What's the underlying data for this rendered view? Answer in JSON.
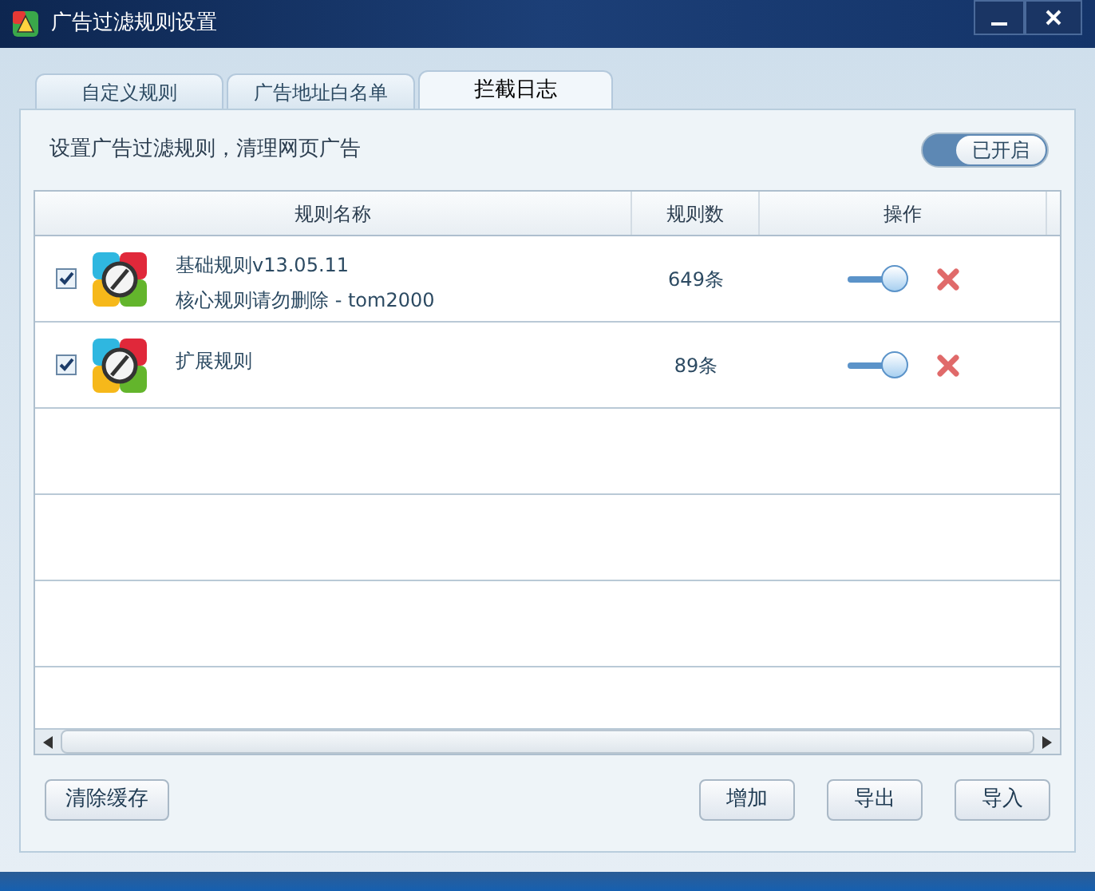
{
  "window": {
    "title": "广告过滤规则设置"
  },
  "tabs": [
    {
      "label": "自定义规则",
      "selected": false
    },
    {
      "label": "广告地址白名单",
      "selected": false
    },
    {
      "label": "拦截日志",
      "selected": true
    }
  ],
  "description": "设置广告过滤规则，清理网页广告",
  "master_switch": {
    "on": true,
    "label": "已开启"
  },
  "table": {
    "columns": [
      "规则名称",
      "规则数",
      "操作"
    ],
    "rows": [
      {
        "checked": true,
        "name": "基础规则v13.05.11",
        "note": "核心规则请勿删除 - tom2000",
        "count": "649条",
        "enabled": true
      },
      {
        "checked": true,
        "name": "扩展规则",
        "count": "89条",
        "enabled": true
      }
    ]
  },
  "buttons_left": [
    "清除缓存"
  ],
  "buttons_right": [
    "增加",
    "导出",
    "导入"
  ]
}
